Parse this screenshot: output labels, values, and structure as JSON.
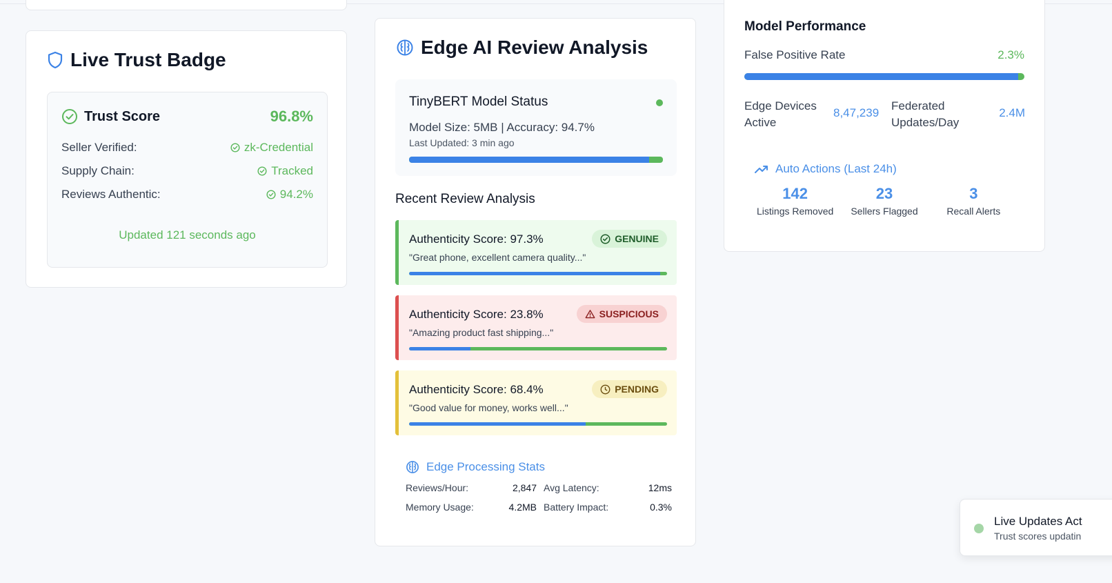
{
  "colors": {
    "accent": "#3b82e6",
    "success": "#5cb85c",
    "danger": "#dc4f4f",
    "warning": "#e3c03a"
  },
  "trust_badge": {
    "title": "Live Trust Badge",
    "score_label": "Trust Score",
    "score_value": "96.8%",
    "rows": [
      {
        "label": "Seller Verified:",
        "value": "zk-Credential"
      },
      {
        "label": "Supply Chain:",
        "value": "Tracked"
      },
      {
        "label": "Reviews Authentic:",
        "value": "94.2%"
      }
    ],
    "updated": "Updated 121 seconds ago"
  },
  "ai_analysis": {
    "title": "Edge AI Review Analysis",
    "model": {
      "name": "TinyBERT Model Status",
      "meta": "Model Size: 5MB | Accuracy: 94.7%",
      "updated": "Last Updated: 3 min ago",
      "accuracy_fraction": 0.947
    },
    "recent_label": "Recent Review Analysis",
    "reviews": [
      {
        "score": "Authenticity Score: 97.3%",
        "quote": "\"Great phone, excellent camera quality...\"",
        "badge": "GENUINE",
        "fraction": 0.973,
        "icon": "check-circle-icon"
      },
      {
        "score": "Authenticity Score: 23.8%",
        "quote": "\"Amazing product fast shipping...\"",
        "badge": "SUSPICIOUS",
        "fraction": 0.238,
        "icon": "warning-icon"
      },
      {
        "score": "Authenticity Score: 68.4%",
        "quote": "\"Good value for money, works well...\"",
        "badge": "PENDING",
        "fraction": 0.684,
        "icon": "clock-icon"
      }
    ],
    "stats": {
      "title": "Edge Processing Stats",
      "items": [
        {
          "label": "Reviews/Hour:",
          "value": "2,847"
        },
        {
          "label": "Avg Latency:",
          "value": "12ms"
        },
        {
          "label": "Memory Usage:",
          "value": "4.2MB"
        },
        {
          "label": "Battery Impact:",
          "value": "0.3%"
        }
      ]
    }
  },
  "model_performance": {
    "title": "Model Performance",
    "fpr_label": "False Positive Rate",
    "fpr_value": "2.3%",
    "fpr_fraction": 0.977,
    "edge_label": "Edge Devices Active",
    "edge_value": "8,47,239",
    "fed_label": "Federated Updates/Day",
    "fed_value": "2.4M",
    "auto_title": "Auto Actions (Last 24h)",
    "auto": [
      {
        "num": "142",
        "label": "Listings Removed"
      },
      {
        "num": "23",
        "label": "Sellers Flagged"
      },
      {
        "num": "3",
        "label": "Recall Alerts"
      }
    ]
  },
  "toast": {
    "title": "Live Updates Act",
    "subtitle": "Trust scores updatin"
  }
}
